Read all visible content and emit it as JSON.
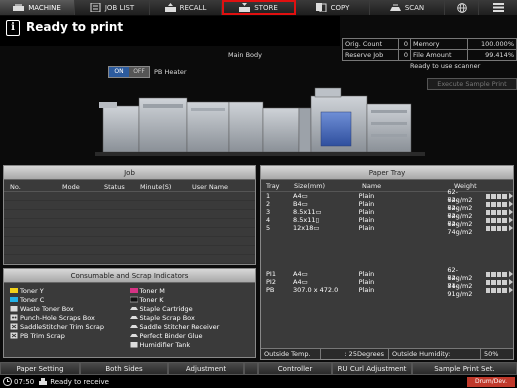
{
  "tabs": [
    {
      "label": "MACHINE",
      "icon": "machine-icon"
    },
    {
      "label": "JOB LIST",
      "icon": "job-list-icon"
    },
    {
      "label": "RECALL",
      "icon": "recall-icon"
    },
    {
      "label": "STORE",
      "icon": "store-icon"
    },
    {
      "label": "COPY",
      "icon": "copy-icon"
    },
    {
      "label": "SCAN",
      "icon": "scan-icon"
    },
    {
      "label": "",
      "icon": "globe-icon"
    },
    {
      "label": "",
      "icon": "menu-icon"
    }
  ],
  "status": {
    "title": "Ready to print",
    "main_body": "Main Body"
  },
  "counts": {
    "orig_count_label": "Orig. Count",
    "orig_count": "0",
    "memory_label": "Memory",
    "memory": "100.000%",
    "reserve_job_label": "Reserve Job",
    "reserve_job": "0",
    "file_amount_label": "File Amount",
    "file_amount": "99.414%"
  },
  "scanner_status": "Ready to use scanner",
  "execute_sample_print": "Execute Sample Print",
  "heater": {
    "on": "ON",
    "off": "OFF",
    "label": "PB Heater"
  },
  "job": {
    "title": "Job",
    "columns": [
      "No.",
      "Mode",
      "Status",
      "Minute(S)",
      "User Name"
    ]
  },
  "consumables": {
    "title": "Consumable and Scrap Indicators",
    "left": [
      "Toner Y",
      "Toner C",
      "Waste Toner Box",
      "Punch-Hole Scraps Box",
      "SaddleStitcher Trim Scrap",
      "PB Trim Scrap"
    ],
    "right": [
      "Toner M",
      "Toner K",
      "Staple Cartridge",
      "Staple Scrap Box",
      "Saddle Stitcher Receiver",
      "Perfect Binder Glue",
      "Humidifier Tank"
    ]
  },
  "paper_tray": {
    "title": "Paper Tray",
    "columns": [
      "Tray",
      "Size(mm)",
      "Name",
      "Weight"
    ],
    "rows": [
      {
        "tray": "1",
        "size": "A4▭",
        "name": "Plain",
        "weight": "62-74g/m2",
        "fill": 1.0
      },
      {
        "tray": "2",
        "size": "B4▭",
        "name": "Plain",
        "weight": "62-74g/m2",
        "fill": 1.0
      },
      {
        "tray": "3",
        "size": "8.5x11▭",
        "name": "Plain",
        "weight": "62-74g/m2",
        "fill": 1.0
      },
      {
        "tray": "4",
        "size": "8.5x11▯",
        "name": "Plain",
        "weight": "62-74g/m2",
        "fill": 1.0
      },
      {
        "tray": "5",
        "size": "12x18▭",
        "name": "Plain",
        "weight": "62-74g/m2",
        "fill": 1.0
      },
      {
        "tray": "PI1",
        "size": "A4▭",
        "name": "Plain",
        "weight": "62-74g/m2",
        "fill": 1.0
      },
      {
        "tray": "PI2",
        "size": "A4▭",
        "name": "Plain",
        "weight": "62-74g/m2",
        "fill": 1.0
      },
      {
        "tray": "PB",
        "size": "307.0 x 472.0",
        "name": "Plain",
        "weight": "81-91g/m2",
        "fill": 1.0
      }
    ],
    "outside_temp_label": "Outside Temp.",
    "outside_temp": ": 25Degrees",
    "outside_humidity_label": "Outside Humidity:",
    "outside_humidity": "50%"
  },
  "bottom_buttons": [
    "Paper Setting",
    "Both Sides",
    "Adjustment",
    "",
    "Controller",
    "RU Curl Adjustment",
    "Sample Print Set."
  ],
  "footer": {
    "time": "07:50",
    "status": "Ready to receive",
    "drum_label": "Drum/Dev."
  },
  "colors": {
    "accent_blue": "#2c5b9e",
    "alert_red": "#e01010"
  }
}
